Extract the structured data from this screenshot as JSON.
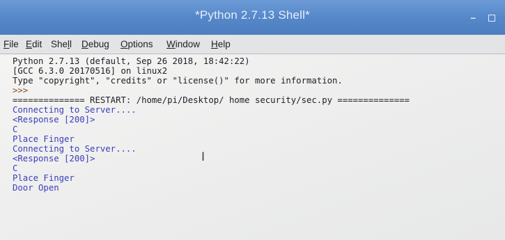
{
  "window": {
    "title": "*Python 2.7.13 Shell*",
    "min_glyph": "–",
    "max_glyph": ""
  },
  "menu": [
    {
      "underline": "F",
      "rest": "ile"
    },
    {
      "underline": "E",
      "rest": "dit"
    },
    {
      "pre": "She",
      "underline": "l",
      "rest": "l"
    },
    {
      "underline": "D",
      "rest": "ebug"
    },
    {
      "underline": "O",
      "rest": "ptions"
    },
    {
      "underline": "W",
      "rest": "indow"
    },
    {
      "underline": "H",
      "rest": "elp"
    }
  ],
  "shell": {
    "lines": [
      "Python 2.7.13 (default, Sep 26 2018, 18:42:22)",
      "[GCC 6.3.0 20170516] on linux2",
      "Type \"copyright\", \"credits\" or \"license()\" for more information.",
      ">>> ",
      "============== RESTART: /home/pi/Desktop/ home security/sec.py ==============",
      "Connecting to Server....",
      "<Response [200]>",
      "C",
      "Place Finger",
      "Connecting to Server....",
      "<Response [200]>",
      "C",
      "Place Finger",
      "Door Open"
    ]
  },
  "colors": {
    "titlebar": "#5486c8",
    "output_blue": "#3a3fb8",
    "prompt_brown": "#8b4a1c",
    "text_black": "#1e1e24"
  },
  "cursor_icon": "text-cursor-ibeam-icon",
  "cursor_glyph": "I"
}
